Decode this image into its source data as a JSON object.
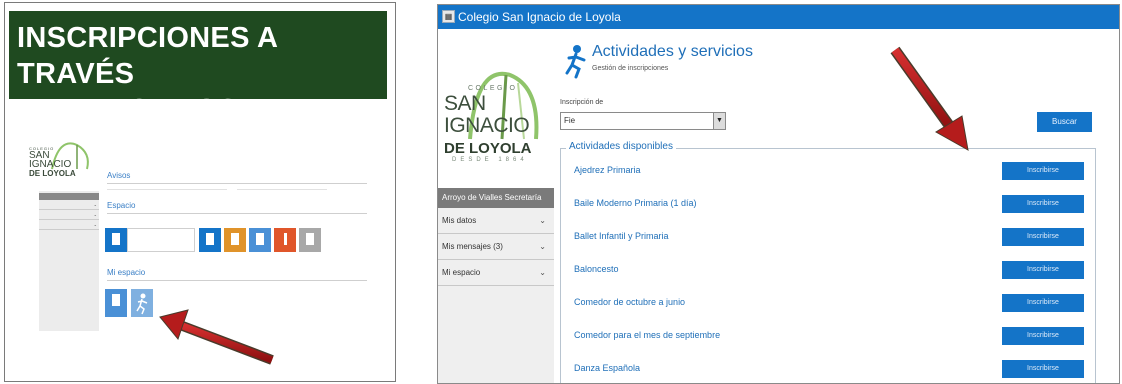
{
  "slide_title": {
    "line1": "INSCRIPCIONES A TRAVÉS",
    "line2": "DE EDUCAMOS"
  },
  "mini_portal": {
    "logo": {
      "small": "COLEGIO",
      "line1": "SAN",
      "line2": "IGNACIO",
      "line3": "DE LOYOLA"
    },
    "section_avisos": "Avisos",
    "section_espacio": "Espacio",
    "section_mi_espacio": "Mi espacio"
  },
  "window": {
    "title": "Colegio San Ignacio de Loyola"
  },
  "logo": {
    "small": "COLEGIO",
    "line1": "SAN",
    "line2": "IGNACIO",
    "line3": "DE LOYOLA",
    "since": "DESDE 1864"
  },
  "header": {
    "title": "Actividades y servicios",
    "subtitle": "Gestión de inscripciones"
  },
  "filter": {
    "label": "Inscripción de",
    "value": "Fie",
    "search_label": "Buscar"
  },
  "sidebar": {
    "heading": "Arroyo de Vialles Secretaría",
    "items": [
      {
        "label": "Mis datos"
      },
      {
        "label": "Mis mensajes (3)"
      },
      {
        "label": "Mi espacio"
      }
    ]
  },
  "activities": {
    "legend": "Actividades disponibles",
    "button_label": "Inscribirse",
    "items": [
      "Ajedrez Primaria",
      "Baile Moderno Primaria (1 día)",
      "Ballet Infantil y Primaria",
      "Baloncesto",
      "Comedor de octubre a junio",
      "Comedor para el mes de septiembre",
      "Danza Española"
    ]
  },
  "colors": {
    "slide_title_bg": "#1f4a20",
    "accent_blue": "#1474c8",
    "arrow_red": "#c21d1d"
  }
}
